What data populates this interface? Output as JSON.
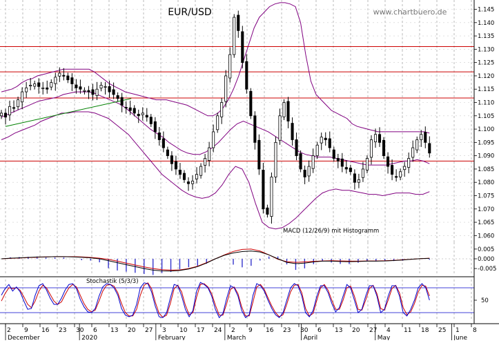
{
  "chart_data": {
    "type": "candlestick",
    "title": "EUR/USD",
    "watermark": "www.chartbuero.de",
    "price_axis": {
      "ylim": [
        1.0575,
        1.1485
      ],
      "ticks": [
        "1.145",
        "1.140",
        "1.135",
        "1.130",
        "1.125",
        "1.120",
        "1.115",
        "1.110",
        "1.105",
        "1.100",
        "1.095",
        "1.090",
        "1.085",
        "1.080",
        "1.075",
        "1.070",
        "1.065",
        "1.060"
      ]
    },
    "horizontal_lines": [
      1.131,
      1.1215,
      1.1117,
      1.088
    ],
    "trend_line": {
      "from": [
        "2019-12-02",
        1.101
      ],
      "to": [
        "2020-01-22",
        1.1115
      ]
    },
    "colors": {
      "up": "#ffffff",
      "down": "#000000",
      "bands": "#800080",
      "resistance": "#cc0000",
      "trend": "#008000",
      "macd": "#000000",
      "signal": "#cc0000",
      "histogram": "#3333cc",
      "stoch_k": "#0000cc",
      "stoch_d": "#cc0000"
    },
    "x_axis": {
      "day_labels": [
        "2",
        "9",
        "16",
        "23",
        "30",
        "6",
        "13",
        "20",
        "27",
        "3",
        "10",
        "17",
        "24",
        "2",
        "9",
        "16",
        "23",
        "30",
        "6",
        "13",
        "20",
        "27",
        "4",
        "11",
        "18",
        "25",
        "1",
        "8"
      ],
      "month_labels": [
        "December",
        "2020",
        "February",
        "March",
        "April",
        "May",
        "June"
      ]
    },
    "macd_label": "MACD (12/26/9) mit Histogramm",
    "macd_axis": {
      "ylim": [
        -0.0078,
        0.0085
      ],
      "ticks": [
        "0.005",
        "0.000",
        "-0.005"
      ]
    },
    "stoch_label": "Stochastik (5/3/3)",
    "stoch_axis": {
      "ylim": [
        0,
        100
      ],
      "ticks": [
        "50"
      ],
      "levels": [
        80,
        20
      ]
    },
    "series": [
      {
        "name": "close",
        "values": [
          1.106,
          1.1045,
          1.1085,
          1.108,
          1.111,
          1.114,
          1.1155,
          1.1165,
          1.117,
          1.116,
          1.1155,
          1.115,
          1.1175,
          1.1195,
          1.121,
          1.12,
          1.1185,
          1.117,
          1.1155,
          1.115,
          1.1145,
          1.114,
          1.113,
          1.115,
          1.1165,
          1.116,
          1.114,
          1.113,
          1.1115,
          1.109,
          1.108,
          1.107,
          1.106,
          1.105,
          1.106,
          1.1045,
          1.102,
          1.099,
          1.096,
          1.093,
          1.09,
          1.087,
          1.085,
          1.083,
          1.081,
          1.0795,
          1.0805,
          1.083,
          1.086,
          1.089,
          1.093,
          1.099,
          1.105,
          1.11,
          1.12,
          1.128,
          1.142,
          1.137,
          1.125,
          1.115,
          1.105,
          1.095,
          1.085,
          1.07,
          1.068,
          1.082,
          1.095,
          1.105,
          1.11,
          1.103,
          1.096,
          1.09,
          1.085,
          1.082,
          1.086,
          1.09,
          1.094,
          1.097,
          1.096,
          1.093,
          1.089,
          1.088,
          1.086,
          1.085,
          1.084,
          1.08,
          1.081,
          1.085,
          1.089,
          1.096,
          1.098,
          1.095,
          1.09,
          1.086,
          1.083,
          1.082,
          1.084,
          1.086,
          1.089,
          1.093,
          1.096,
          1.098,
          1.095,
          1.091
        ]
      },
      {
        "name": "upper_band",
        "values": [
          1.114,
          1.1145,
          1.115,
          1.116,
          1.1175,
          1.1185,
          1.119,
          1.12,
          1.1205,
          1.121,
          1.1215,
          1.122,
          1.1225,
          1.1225,
          1.1225,
          1.1225,
          1.1225,
          1.1225,
          1.1215,
          1.12,
          1.1185,
          1.117,
          1.116,
          1.115,
          1.114,
          1.1135,
          1.113,
          1.1125,
          1.112,
          1.1115,
          1.111,
          1.111,
          1.111,
          1.1105,
          1.11,
          1.1095,
          1.109,
          1.108,
          1.107,
          1.106,
          1.105,
          1.105,
          1.106,
          1.108,
          1.111,
          1.115,
          1.12,
          1.126,
          1.132,
          1.138,
          1.142,
          1.144,
          1.146,
          1.147,
          1.1475,
          1.1475,
          1.147,
          1.146,
          1.14,
          1.128,
          1.118,
          1.113,
          1.111,
          1.109,
          1.107,
          1.106,
          1.105,
          1.104,
          1.102,
          1.101,
          1.1005,
          1.1,
          1.0995,
          1.099,
          1.099,
          1.099,
          1.099,
          1.099,
          1.099,
          1.099,
          1.099,
          1.099,
          1.099,
          1.0985
        ]
      },
      {
        "name": "middle_band",
        "values": [
          1.1045,
          1.1055,
          1.1065,
          1.1075,
          1.1085,
          1.1095,
          1.1105,
          1.111,
          1.1115,
          1.112,
          1.113,
          1.1135,
          1.114,
          1.114,
          1.114,
          1.1135,
          1.1125,
          1.1115,
          1.1105,
          1.1095,
          1.108,
          1.106,
          1.104,
          1.102,
          1.1,
          1.0985,
          1.097,
          1.095,
          1.0935,
          1.092,
          1.091,
          1.0905,
          1.0905,
          1.0915,
          1.093,
          1.095,
          1.0975,
          1.1,
          1.102,
          1.103,
          1.102,
          1.101,
          1.1,
          1.099,
          1.0975,
          1.096,
          1.0945,
          1.093,
          1.0915,
          1.0905,
          1.09,
          1.0895,
          1.0895,
          1.0895,
          1.089,
          1.0885,
          1.088,
          1.0875,
          1.087,
          1.0865,
          1.0865,
          1.0865,
          1.0865,
          1.087,
          1.0875,
          1.088,
          1.088,
          1.0885,
          1.088,
          1.087
        ]
      },
      {
        "name": "lower_band",
        "values": [
          1.096,
          1.097,
          1.0985,
          1.0995,
          1.1005,
          1.1015,
          1.103,
          1.104,
          1.105,
          1.106,
          1.106,
          1.1065,
          1.1065,
          1.1065,
          1.106,
          1.105,
          1.104,
          1.102,
          1.1,
          1.098,
          1.095,
          1.092,
          1.089,
          1.086,
          1.083,
          1.081,
          1.079,
          1.077,
          1.0755,
          1.0745,
          1.074,
          1.0745,
          1.076,
          1.079,
          1.083,
          1.086,
          1.085,
          1.08,
          1.072,
          1.065,
          1.063,
          1.0625,
          1.063,
          1.0645,
          1.0665,
          1.069,
          1.0715,
          1.074,
          1.076,
          1.077,
          1.0775,
          1.077,
          1.077,
          1.0765,
          1.076,
          1.0755,
          1.0755,
          1.075,
          1.0755,
          1.076,
          1.076,
          1.076,
          1.0755,
          1.0755,
          1.0765
        ]
      },
      {
        "name": "macd",
        "values": [
          0.0,
          0.0003,
          0.0005,
          0.0007,
          0.0009,
          0.001,
          0.0011,
          0.0011,
          0.001,
          0.0008,
          0.0005,
          0.0,
          -0.001,
          -0.002,
          -0.003,
          -0.004,
          -0.005,
          -0.0058,
          -0.0062,
          -0.0063,
          -0.006,
          -0.0052,
          -0.004,
          -0.0022,
          0.0,
          0.0018,
          0.003,
          0.0037,
          0.004,
          0.0035,
          0.002,
          0.0,
          -0.0018,
          -0.0025,
          -0.0022,
          -0.0016,
          -0.0012,
          -0.0012,
          -0.0014,
          -0.0015,
          -0.0014,
          -0.0012,
          -0.0012,
          -0.0011,
          -0.0009,
          -0.0006,
          -0.0002,
          0.0001,
          0.0002
        ]
      },
      {
        "name": "signal",
        "values": [
          0.0,
          0.0002,
          0.0004,
          0.0006,
          0.0008,
          0.001,
          0.0011,
          0.0011,
          0.0011,
          0.001,
          0.0007,
          0.0003,
          -0.0003,
          -0.0012,
          -0.0022,
          -0.0032,
          -0.0042,
          -0.005,
          -0.0056,
          -0.0058,
          -0.0057,
          -0.005,
          -0.0038,
          -0.002,
          0.0,
          0.002,
          0.0038,
          0.0048,
          0.005,
          0.004,
          0.002,
          -0.0002,
          -0.0015,
          -0.0018,
          -0.0016,
          -0.0013,
          -0.0011,
          -0.001,
          -0.0011,
          -0.0012,
          -0.0012,
          -0.0011,
          -0.0011,
          -0.001,
          -0.0008,
          -0.0005,
          -0.0002,
          0.0001,
          0.0003
        ]
      },
      {
        "name": "stoch_k",
        "values": [
          62,
          78,
          88,
          72,
          82,
          70,
          48,
          28,
          30,
          62,
          85,
          90,
          75,
          55,
          40,
          40,
          55,
          75,
          88,
          90,
          78,
          52,
          34,
          22,
          20,
          30,
          60,
          82,
          90,
          88,
          80,
          62,
          30,
          14,
          10,
          14,
          40,
          80,
          92,
          90,
          70,
          35,
          10,
          8,
          20,
          55,
          88,
          85,
          60,
          28,
          10,
          25,
          72,
          93,
          88,
          80,
          60,
          28,
          8,
          18,
          55,
          85,
          80,
          60,
          25,
          8,
          15,
          62,
          90,
          85,
          72,
          50,
          30,
          15,
          8,
          20,
          50,
          80,
          90,
          85,
          60,
          20,
          10,
          25,
          60,
          85,
          85,
          68,
          42,
          22,
          32,
          60,
          88,
          80,
          50,
          20,
          28,
          60,
          85,
          85,
          60,
          20,
          28,
          60,
          85,
          85,
          60,
          20,
          12,
          28,
          50,
          80,
          90,
          80,
          50
        ]
      },
      {
        "name": "stoch_d",
        "values": [
          48,
          66,
          80,
          78,
          80,
          74,
          58,
          40,
          32,
          48,
          72,
          86,
          80,
          64,
          48,
          40,
          46,
          64,
          80,
          88,
          82,
          62,
          42,
          28,
          22,
          26,
          48,
          72,
          86,
          88,
          84,
          68,
          42,
          20,
          12,
          12,
          28,
          62,
          86,
          92,
          78,
          45,
          18,
          9,
          14,
          42,
          78,
          86,
          70,
          38,
          15,
          20,
          58,
          88,
          90,
          82,
          66,
          38,
          14,
          14,
          42,
          76,
          82,
          66,
          34,
          12,
          12,
          46,
          82,
          88,
          76,
          56,
          36,
          20,
          10,
          15,
          40,
          70,
          86,
          88,
          68,
          30,
          12,
          18,
          50,
          80,
          88,
          74,
          50,
          28,
          28,
          50,
          80,
          84,
          60,
          28,
          26,
          50,
          78,
          86,
          66,
          30,
          26,
          50,
          78,
          86,
          68,
          32,
          15,
          22,
          42,
          70,
          86,
          84,
          60
        ]
      }
    ]
  }
}
